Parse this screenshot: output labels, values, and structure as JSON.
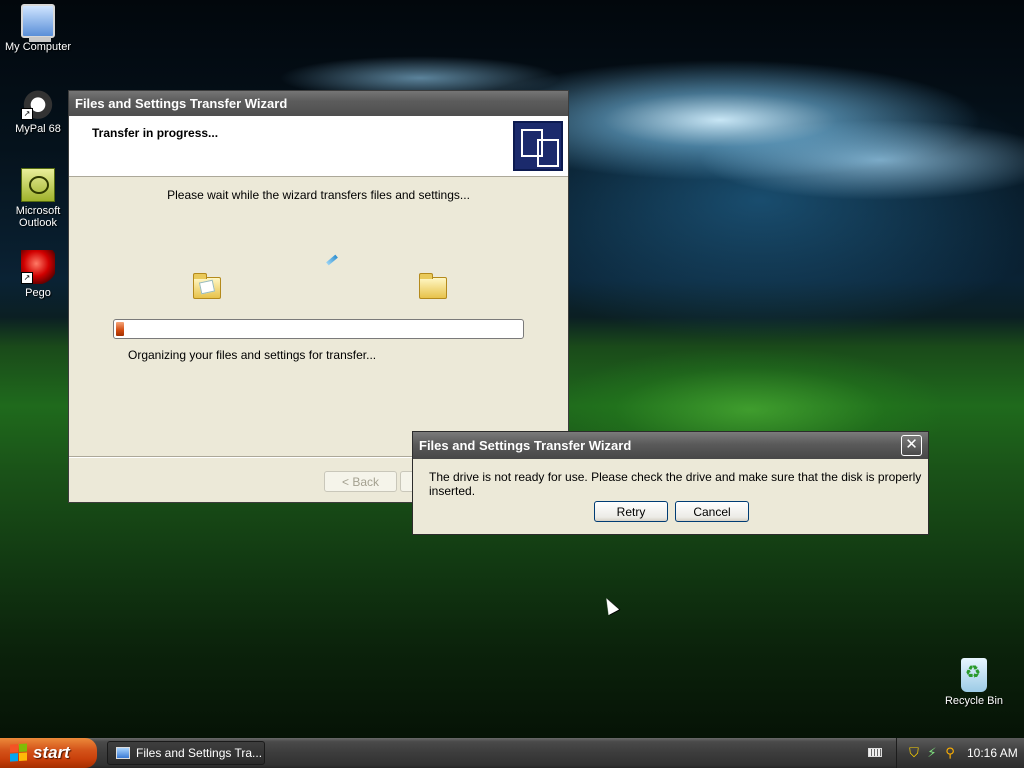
{
  "desktop": {
    "icons": [
      {
        "label": "My Computer",
        "icon": "my-computer-icon"
      },
      {
        "label": "MyPal 68",
        "icon": "mypal-icon"
      },
      {
        "label": "Microsoft Outlook",
        "icon": "outlook-icon"
      },
      {
        "label": "Pego",
        "icon": "pego-icon"
      },
      {
        "label": "Recycle Bin",
        "icon": "recycle-bin-icon"
      }
    ]
  },
  "wizard": {
    "title": "Files and Settings Transfer Wizard",
    "header_title": "Transfer in progress...",
    "instruction": "Please wait while the wizard transfers files and settings...",
    "progress_fraction": 0.02,
    "status": "Organizing your files and settings for transfer...",
    "back_label": "< Back",
    "next_label": ""
  },
  "dialog": {
    "title": "Files and Settings Transfer Wizard",
    "close_symbol": "✕",
    "message": "The drive is not ready for use. Please check the drive and make sure that the disk is properly inserted.",
    "retry_label": "Retry",
    "cancel_label": "Cancel"
  },
  "taskbar": {
    "start_label": "start",
    "tasks": [
      {
        "label": "Files and Settings Tra..."
      }
    ],
    "tray_icons": [
      "security-shield-icon",
      "network-icon",
      "search-icon"
    ],
    "clock": "10:16 AM"
  }
}
